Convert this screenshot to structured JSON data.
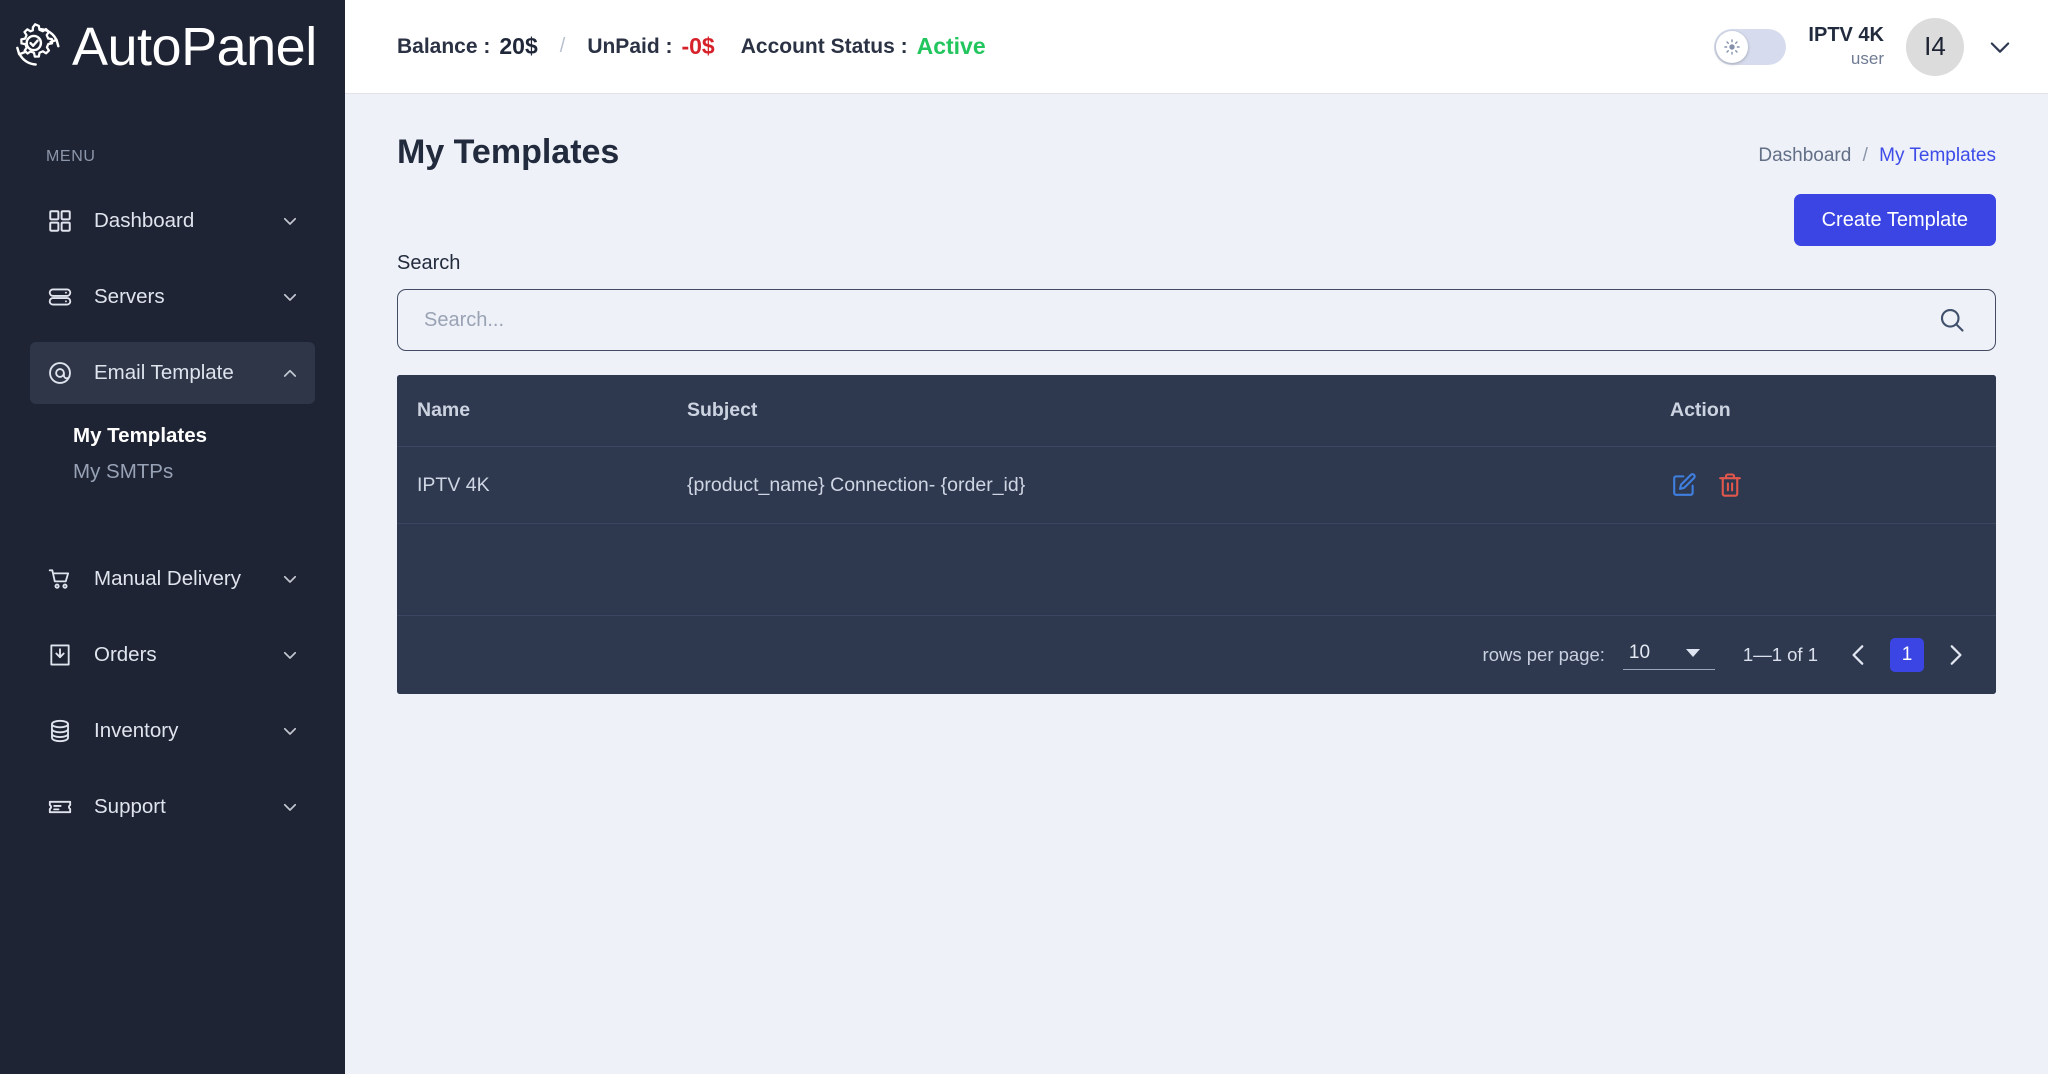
{
  "brand": {
    "name": "AutoPanel",
    "logo_icon": "gear-check-refresh-icon"
  },
  "topbar": {
    "balance_label": "Balance :",
    "balance_value": "20$",
    "separator": "/",
    "unpaid_label": "UnPaid :",
    "unpaid_value": "-0$",
    "status_label": "Account Status :",
    "status_value": "Active",
    "theme_toggle_icon": "sun-icon",
    "user_name": "IPTV 4K",
    "user_role": "user",
    "avatar_initials": "I4",
    "caret_icon": "chevron-down-icon"
  },
  "sidebar": {
    "section_label": "MENU",
    "items": [
      {
        "label": "Dashboard",
        "icon": "grid-icon",
        "chevron": "chevron-down-icon",
        "active": false
      },
      {
        "label": "Servers",
        "icon": "server-icon",
        "chevron": "chevron-down-icon",
        "active": false
      },
      {
        "label": "Email Template",
        "icon": "at-sign-icon",
        "chevron": "chevron-up-icon",
        "active": true
      },
      {
        "label": "Manual Delivery",
        "icon": "shopping-cart-icon",
        "chevron": "chevron-down-icon",
        "active": false
      },
      {
        "label": "Orders",
        "icon": "download-box-icon",
        "chevron": "chevron-down-icon",
        "active": false
      },
      {
        "label": "Inventory",
        "icon": "database-icon",
        "chevron": "chevron-down-icon",
        "active": false
      },
      {
        "label": "Support",
        "icon": "ticket-icon",
        "chevron": "chevron-down-icon",
        "active": false
      }
    ],
    "submenu": [
      {
        "label": "My Templates",
        "active": true
      },
      {
        "label": "My SMTPs",
        "active": false
      }
    ]
  },
  "page": {
    "title": "My Templates",
    "breadcrumb_root": "Dashboard",
    "breadcrumb_sep": "/",
    "breadcrumb_current": "My Templates",
    "create_button": "Create Template"
  },
  "search": {
    "label": "Search",
    "placeholder": "Search...",
    "value": "",
    "icon": "search-icon"
  },
  "table": {
    "columns": [
      "Name",
      "Subject",
      "Action"
    ],
    "rows": [
      {
        "name": "IPTV 4K",
        "subject": "{product_name} Connection- {order_id}",
        "edit_icon": "edit-pencil-icon",
        "delete_icon": "trash-icon"
      }
    ]
  },
  "pagination": {
    "rows_per_page_label": "rows per page:",
    "rows_per_page_value": "10",
    "range": "1—1 of 1",
    "prev_icon": "chevron-left-icon",
    "next_icon": "chevron-right-icon",
    "current_page": "1"
  },
  "colors": {
    "sidebar_bg": "#1e2433",
    "accent_blue": "#3b45e4",
    "status_green": "#22c55e",
    "unpaid_red": "#d6212a",
    "table_bg": "#2e3950",
    "edit_blue": "#3f7fe0",
    "delete_red": "#e2574c",
    "page_bg": "#eef1f7"
  }
}
